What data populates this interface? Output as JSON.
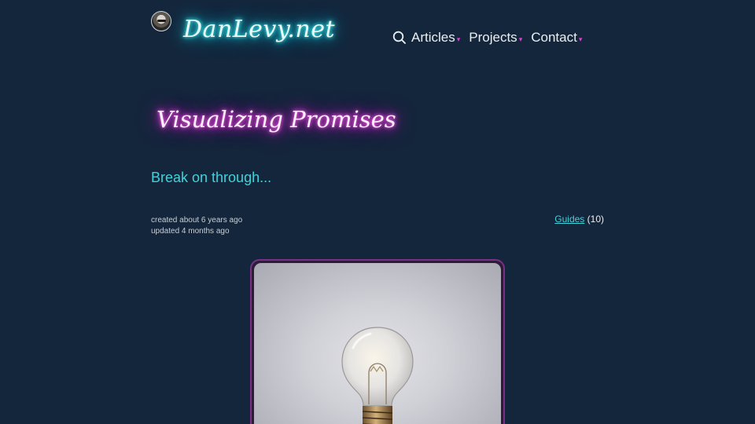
{
  "header": {
    "site_logo": "DanLevy.net",
    "nav": [
      {
        "label": "Articles"
      },
      {
        "label": "Projects"
      },
      {
        "label": "Contact"
      }
    ]
  },
  "post": {
    "title": "Visualizing Promises",
    "subtitle": "Break on through...",
    "created": "created about 6 years ago",
    "updated": "updated 4 months ago",
    "tag": {
      "label": "Guides",
      "count": "(10)"
    }
  },
  "colors": {
    "background": "#14263b",
    "accent_cyan": "#3fd3dc",
    "accent_magenta": "#e23dd5"
  },
  "icons": {
    "search": "search-icon",
    "caret": "chevron-down-icon"
  }
}
